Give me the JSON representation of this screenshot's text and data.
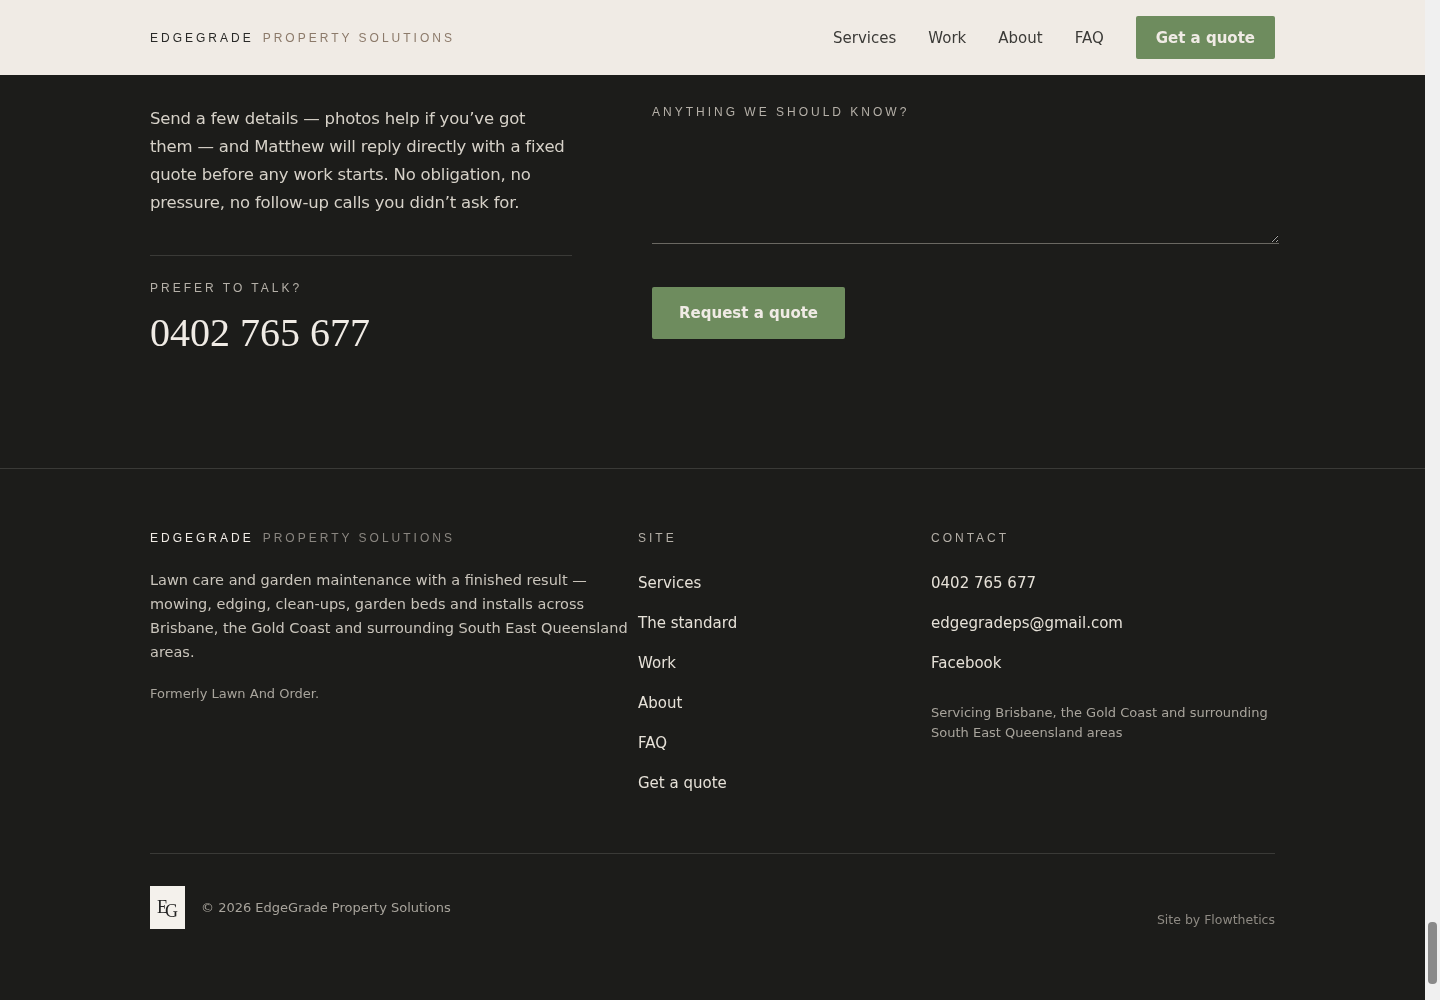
{
  "header": {
    "brand": {
      "primary": "EDGEGRADE",
      "secondary": "PROPERTY SOLUTIONS"
    },
    "nav": [
      {
        "label": "Services"
      },
      {
        "label": "Work"
      },
      {
        "label": "About"
      },
      {
        "label": "FAQ"
      }
    ],
    "cta": "Get a quote"
  },
  "intro": {
    "paragraph": "Send a few details — photos help if you’ve got them — and Matthew will reply directly with a fixed quote before any work starts. No obligation, no pressure, no follow-up calls you didn’t ask for.",
    "talk_label": "PREFER TO TALK?",
    "phone": "0402 765 677"
  },
  "form": {
    "field_label": "ANYTHING WE SHOULD KNOW?",
    "submit": "Request a quote"
  },
  "footer": {
    "brand": {
      "primary": "EDGEGRADE",
      "secondary": "PROPERTY SOLUTIONS"
    },
    "about": "Lawn care and garden maintenance with a finished result — mowing, edging, clean-ups, garden beds and installs across Brisbane, the Gold Coast and surrounding South East Queensland areas.",
    "formerly": "Formerly Lawn And Order.",
    "site_heading": "SITE",
    "site_links": [
      {
        "label": "Services"
      },
      {
        "label": "The standard"
      },
      {
        "label": "Work"
      },
      {
        "label": "About"
      },
      {
        "label": "FAQ"
      },
      {
        "label": "Get a quote"
      }
    ],
    "contact_heading": "CONTACT",
    "contact_links": [
      {
        "label": "0402 765 677"
      },
      {
        "label": "edgegradeps@gmail.com"
      },
      {
        "label": "Facebook"
      }
    ],
    "service_area": "Servicing Brisbane, the Gold Coast and surrounding South East Queensland areas",
    "logo_mark": {
      "first": "E",
      "second": "G"
    },
    "copyright": "© 2026 EdgeGrade Property Solutions",
    "credit": "Site by Flowthetics"
  }
}
